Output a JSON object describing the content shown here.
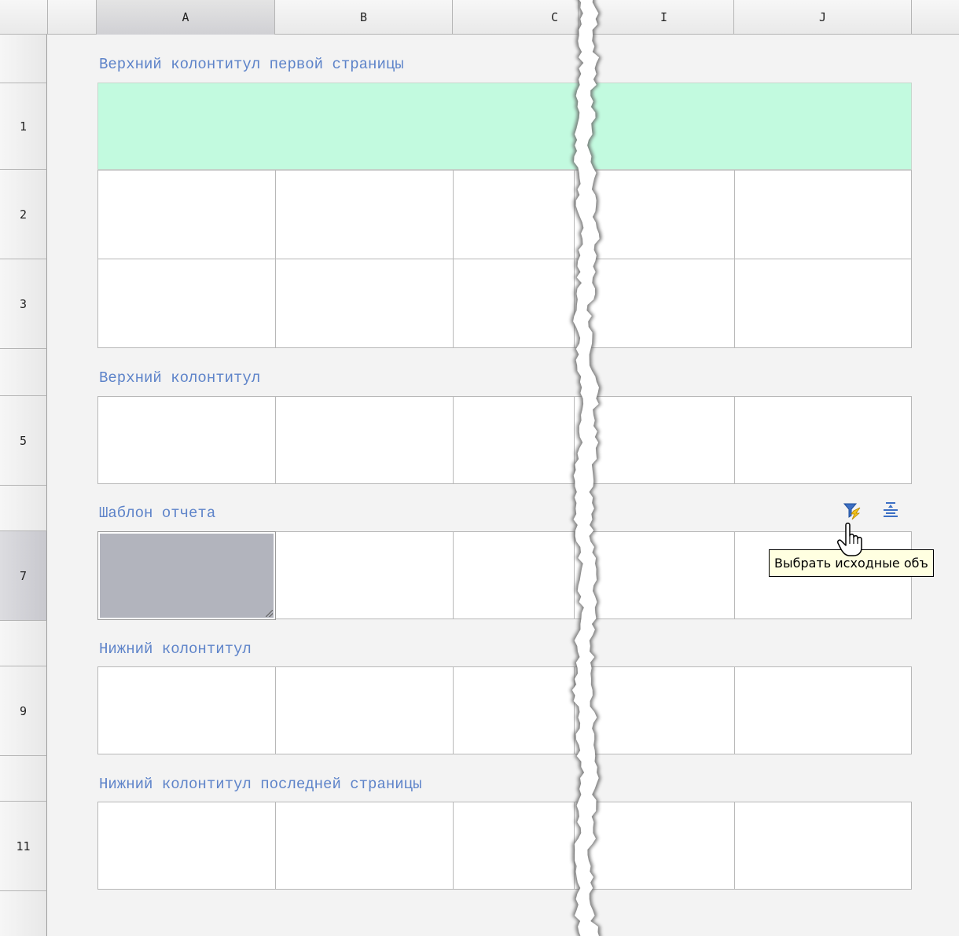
{
  "columns": [
    "A",
    "B",
    "C",
    "I",
    "J"
  ],
  "rows": [
    "1",
    "2",
    "3",
    "",
    "5",
    "",
    "7",
    "",
    "9",
    "",
    "11",
    ""
  ],
  "sections": [
    {
      "title": "Верхний колонтитул первой страницы"
    },
    {
      "title": "Верхний колонтитул"
    },
    {
      "title": "Шаблон отчета"
    },
    {
      "title": "Нижний колонтитул"
    },
    {
      "title": "Нижний колонтитул последней страницы"
    }
  ],
  "selected_cell": "A7",
  "selected_column": "A",
  "selected_row": "7",
  "toolbar_icons": [
    "filter-select-objects-icon",
    "text-align-icon"
  ],
  "tooltip": {
    "text": "Выбрать исходные объ"
  },
  "colors": {
    "section_title": "#5d83c9",
    "first_page_header_fill": "#c2fadf",
    "selected_cell": "#b2b4bd",
    "tooltip_bg": "#ffffe1"
  }
}
